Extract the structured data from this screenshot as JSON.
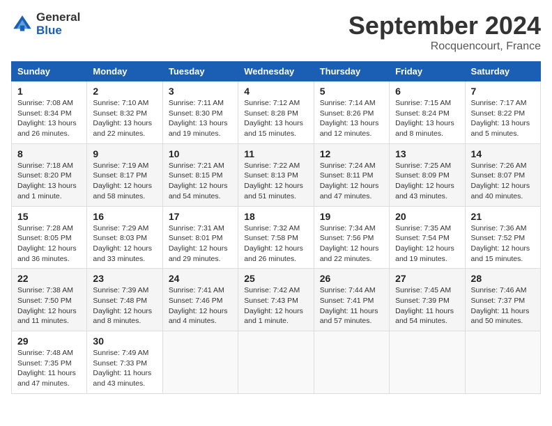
{
  "header": {
    "logo_general": "General",
    "logo_blue": "Blue",
    "month_title": "September 2024",
    "location": "Rocquencourt, France"
  },
  "weekdays": [
    "Sunday",
    "Monday",
    "Tuesday",
    "Wednesday",
    "Thursday",
    "Friday",
    "Saturday"
  ],
  "weeks": [
    [
      {
        "day": "1",
        "detail": "Sunrise: 7:08 AM\nSunset: 8:34 PM\nDaylight: 13 hours\nand 26 minutes."
      },
      {
        "day": "2",
        "detail": "Sunrise: 7:10 AM\nSunset: 8:32 PM\nDaylight: 13 hours\nand 22 minutes."
      },
      {
        "day": "3",
        "detail": "Sunrise: 7:11 AM\nSunset: 8:30 PM\nDaylight: 13 hours\nand 19 minutes."
      },
      {
        "day": "4",
        "detail": "Sunrise: 7:12 AM\nSunset: 8:28 PM\nDaylight: 13 hours\nand 15 minutes."
      },
      {
        "day": "5",
        "detail": "Sunrise: 7:14 AM\nSunset: 8:26 PM\nDaylight: 13 hours\nand 12 minutes."
      },
      {
        "day": "6",
        "detail": "Sunrise: 7:15 AM\nSunset: 8:24 PM\nDaylight: 13 hours\nand 8 minutes."
      },
      {
        "day": "7",
        "detail": "Sunrise: 7:17 AM\nSunset: 8:22 PM\nDaylight: 13 hours\nand 5 minutes."
      }
    ],
    [
      {
        "day": "8",
        "detail": "Sunrise: 7:18 AM\nSunset: 8:20 PM\nDaylight: 13 hours\nand 1 minute."
      },
      {
        "day": "9",
        "detail": "Sunrise: 7:19 AM\nSunset: 8:17 PM\nDaylight: 12 hours\nand 58 minutes."
      },
      {
        "day": "10",
        "detail": "Sunrise: 7:21 AM\nSunset: 8:15 PM\nDaylight: 12 hours\nand 54 minutes."
      },
      {
        "day": "11",
        "detail": "Sunrise: 7:22 AM\nSunset: 8:13 PM\nDaylight: 12 hours\nand 51 minutes."
      },
      {
        "day": "12",
        "detail": "Sunrise: 7:24 AM\nSunset: 8:11 PM\nDaylight: 12 hours\nand 47 minutes."
      },
      {
        "day": "13",
        "detail": "Sunrise: 7:25 AM\nSunset: 8:09 PM\nDaylight: 12 hours\nand 43 minutes."
      },
      {
        "day": "14",
        "detail": "Sunrise: 7:26 AM\nSunset: 8:07 PM\nDaylight: 12 hours\nand 40 minutes."
      }
    ],
    [
      {
        "day": "15",
        "detail": "Sunrise: 7:28 AM\nSunset: 8:05 PM\nDaylight: 12 hours\nand 36 minutes."
      },
      {
        "day": "16",
        "detail": "Sunrise: 7:29 AM\nSunset: 8:03 PM\nDaylight: 12 hours\nand 33 minutes."
      },
      {
        "day": "17",
        "detail": "Sunrise: 7:31 AM\nSunset: 8:01 PM\nDaylight: 12 hours\nand 29 minutes."
      },
      {
        "day": "18",
        "detail": "Sunrise: 7:32 AM\nSunset: 7:58 PM\nDaylight: 12 hours\nand 26 minutes."
      },
      {
        "day": "19",
        "detail": "Sunrise: 7:34 AM\nSunset: 7:56 PM\nDaylight: 12 hours\nand 22 minutes."
      },
      {
        "day": "20",
        "detail": "Sunrise: 7:35 AM\nSunset: 7:54 PM\nDaylight: 12 hours\nand 19 minutes."
      },
      {
        "day": "21",
        "detail": "Sunrise: 7:36 AM\nSunset: 7:52 PM\nDaylight: 12 hours\nand 15 minutes."
      }
    ],
    [
      {
        "day": "22",
        "detail": "Sunrise: 7:38 AM\nSunset: 7:50 PM\nDaylight: 12 hours\nand 11 minutes."
      },
      {
        "day": "23",
        "detail": "Sunrise: 7:39 AM\nSunset: 7:48 PM\nDaylight: 12 hours\nand 8 minutes."
      },
      {
        "day": "24",
        "detail": "Sunrise: 7:41 AM\nSunset: 7:46 PM\nDaylight: 12 hours\nand 4 minutes."
      },
      {
        "day": "25",
        "detail": "Sunrise: 7:42 AM\nSunset: 7:43 PM\nDaylight: 12 hours\nand 1 minute."
      },
      {
        "day": "26",
        "detail": "Sunrise: 7:44 AM\nSunset: 7:41 PM\nDaylight: 11 hours\nand 57 minutes."
      },
      {
        "day": "27",
        "detail": "Sunrise: 7:45 AM\nSunset: 7:39 PM\nDaylight: 11 hours\nand 54 minutes."
      },
      {
        "day": "28",
        "detail": "Sunrise: 7:46 AM\nSunset: 7:37 PM\nDaylight: 11 hours\nand 50 minutes."
      }
    ],
    [
      {
        "day": "29",
        "detail": "Sunrise: 7:48 AM\nSunset: 7:35 PM\nDaylight: 11 hours\nand 47 minutes."
      },
      {
        "day": "30",
        "detail": "Sunrise: 7:49 AM\nSunset: 7:33 PM\nDaylight: 11 hours\nand 43 minutes."
      },
      {
        "day": "",
        "detail": ""
      },
      {
        "day": "",
        "detail": ""
      },
      {
        "day": "",
        "detail": ""
      },
      {
        "day": "",
        "detail": ""
      },
      {
        "day": "",
        "detail": ""
      }
    ]
  ]
}
